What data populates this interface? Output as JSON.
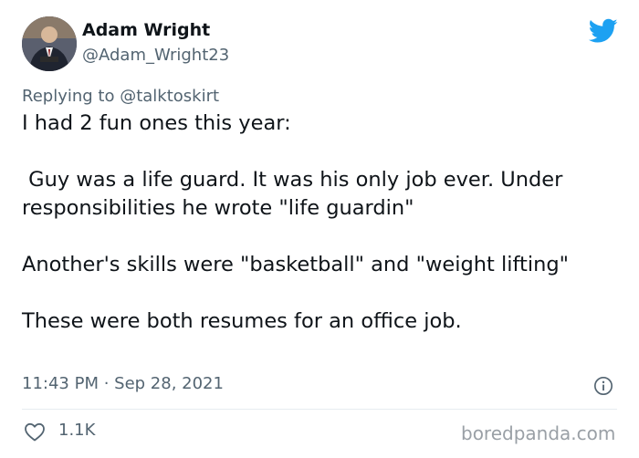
{
  "author": {
    "display_name": "Adam Wright",
    "handle": "@Adam_Wright23",
    "avatar_icon": "profile-photo"
  },
  "reply": {
    "prefix": "Replying to ",
    "mention": "@talktoskirt"
  },
  "tweet": {
    "paragraphs": [
      "I had 2 fun ones this year:",
      " Guy was a life guard. It was his only job ever. Under responsibilities he wrote \"life guardin\"",
      "Another's skills were \"basketball\" and \"weight lifting\"",
      "These were both resumes for an office job."
    ]
  },
  "meta": {
    "timestamp": "11:43 PM · Sep 28, 2021",
    "info_icon": "info-icon"
  },
  "actions": {
    "like_icon": "heart-icon",
    "like_count": "1.1K"
  },
  "brand": {
    "logo_icon": "twitter-bird-icon",
    "accent": "#1da1f2",
    "watermark": "boredpanda.com"
  }
}
